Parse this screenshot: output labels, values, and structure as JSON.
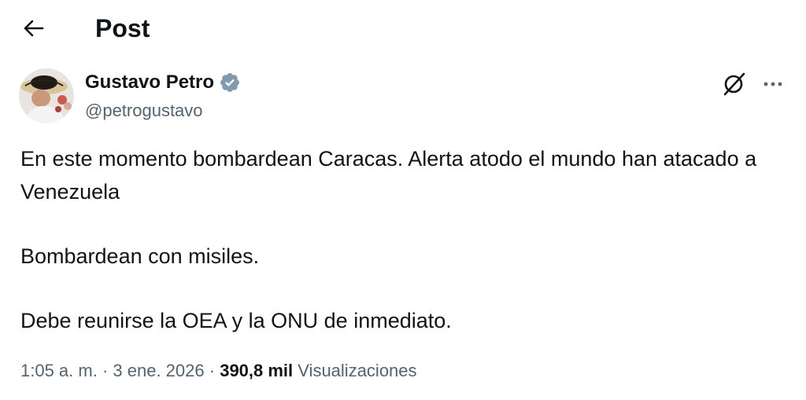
{
  "header": {
    "title": "Post",
    "back_icon": "arrow-left-icon"
  },
  "post": {
    "author": {
      "name": "Gustavo Petro",
      "handle": "@petrogustavo",
      "verified_badge": "verified-icon",
      "avatar": "avatar"
    },
    "actions": {
      "grok_icon": "grok-icon",
      "more_icon": "more-horizontal-icon"
    },
    "text": {
      "p1": "En este momento bombardean Caracas. Alerta atodo el mundo han atacado a Venezuela",
      "p2": "Bombardean con misiles.",
      "p3": "Debe reunirse la OEA y la ONU de inmediato."
    },
    "meta": {
      "time": "1:05 a. m.",
      "sep1": " · ",
      "date": "3 ene. 2026",
      "sep2": " · ",
      "views_count": "390,8 mil",
      "views_label": "Visualizaciones"
    }
  },
  "colors": {
    "text": "#0f1419",
    "secondary": "#536471",
    "verified": "#829aab"
  }
}
